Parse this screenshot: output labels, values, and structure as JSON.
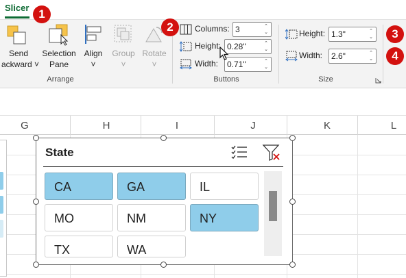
{
  "ribbon": {
    "tab_label": "Slicer",
    "arrange": {
      "group_label": "Arrange",
      "send_backward": {
        "line1": "Send",
        "line2": "ackward ˅"
      },
      "selection_pane": {
        "line1": "Selection",
        "line2": "Pane"
      },
      "align": {
        "line1": "Align",
        "line2": "˅"
      },
      "group": {
        "line1": "Group",
        "line2": "˅"
      },
      "rotate": {
        "line1": "Rotate",
        "line2": "˅"
      }
    },
    "buttons": {
      "group_label": "Buttons",
      "columns_label": "Columns:",
      "columns_value": "3",
      "height_label": "Height:",
      "height_value": "0.28\"",
      "width_label": "Width:",
      "width_value": "0.71\""
    },
    "size": {
      "group_label": "Size",
      "height_label": "Height:",
      "height_value": "1.3\"",
      "width_label": "Width:",
      "width_value": "2.6\""
    }
  },
  "badges": [
    "1",
    "2",
    "3",
    "4"
  ],
  "sheet": {
    "columns": [
      "G",
      "H",
      "I",
      "J",
      "K",
      "L"
    ]
  },
  "slicer": {
    "title": "State",
    "items": [
      {
        "label": "CA",
        "selected": true
      },
      {
        "label": "GA",
        "selected": true
      },
      {
        "label": "IL",
        "selected": false
      },
      {
        "label": "MO",
        "selected": false
      },
      {
        "label": "NM",
        "selected": false
      },
      {
        "label": "NY",
        "selected": true
      },
      {
        "label": "TX",
        "selected": false
      },
      {
        "label": "WA",
        "selected": false
      }
    ],
    "icons": [
      "multi-select-icon",
      "clear-filter-icon"
    ]
  },
  "colors": {
    "accent_green": "#0e6b34",
    "badge_red": "#d3110f",
    "selected_item": "#8fcdea"
  }
}
